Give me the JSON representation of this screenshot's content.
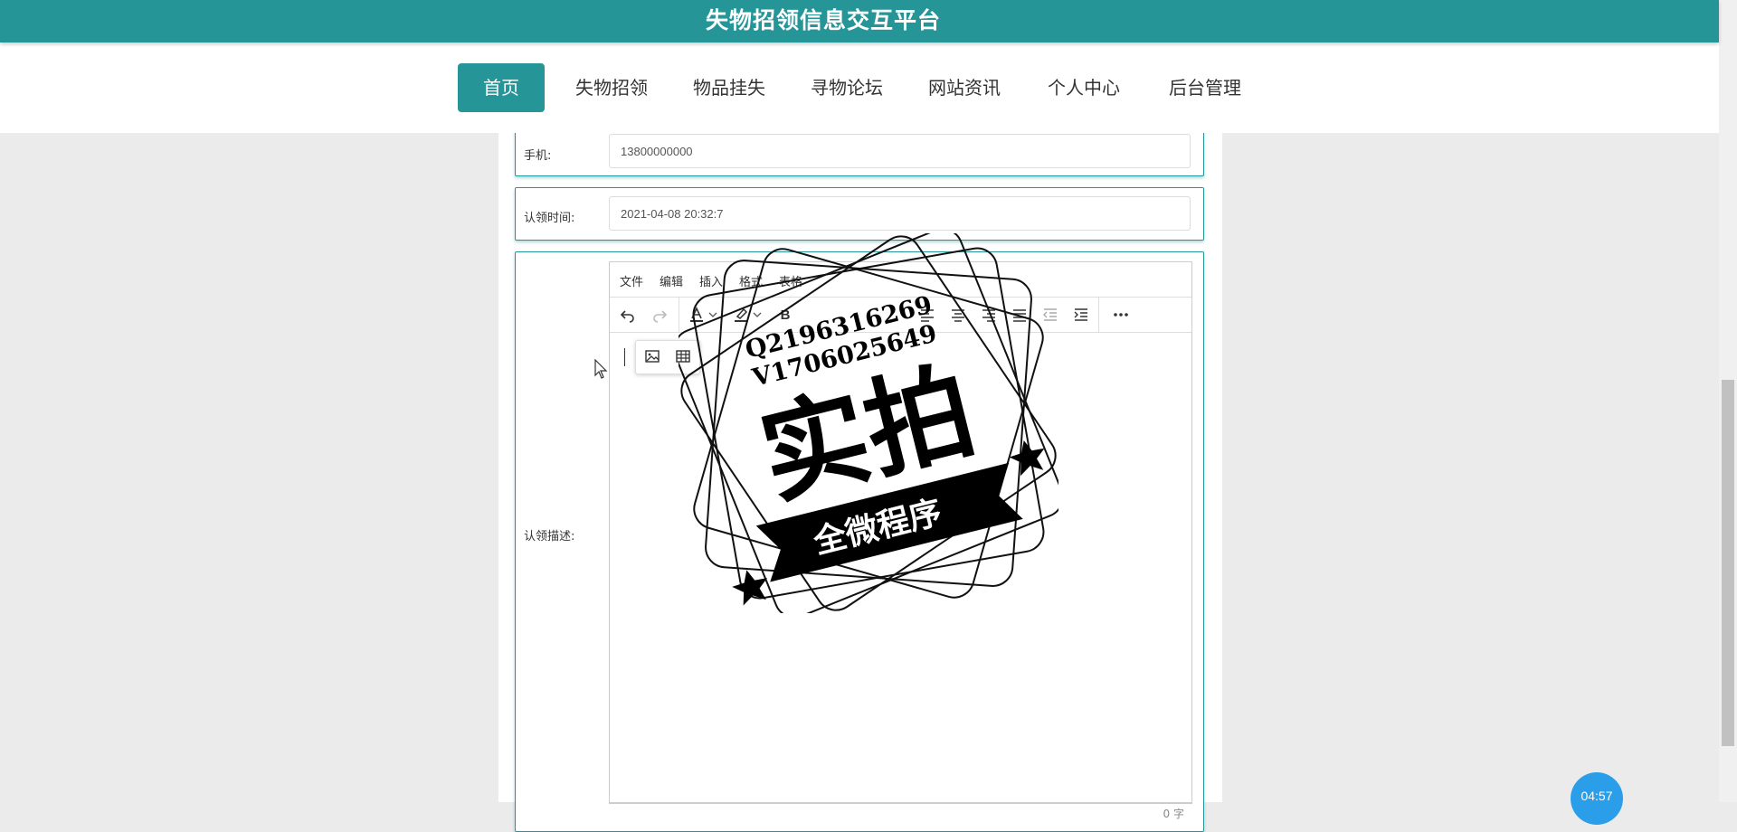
{
  "header": {
    "title": "失物招领信息交互平台"
  },
  "nav": {
    "items": [
      {
        "label": "首页"
      },
      {
        "label": "失物招领"
      },
      {
        "label": "物品挂失"
      },
      {
        "label": "寻物论坛"
      },
      {
        "label": "网站资讯"
      },
      {
        "label": "个人中心"
      },
      {
        "label": "后台管理"
      }
    ]
  },
  "form": {
    "phone": {
      "label": "手机:",
      "value": "13800000000"
    },
    "claim_time": {
      "label": "认领时间:",
      "value": "2021-04-08 20:32:7"
    },
    "description": {
      "label": "认领描述:"
    }
  },
  "editor": {
    "menus": [
      "文件",
      "编辑",
      "插入",
      "格式",
      "表格"
    ],
    "word_count": "0 字"
  },
  "watermark": {
    "contact_q": "Q2196316269",
    "contact_v": "V1706025649",
    "main_text": "实拍",
    "banner_text": "全微程序"
  },
  "timer": {
    "value": "04:57"
  },
  "colors": {
    "brand": "#269598",
    "timer": "#2a9ee8"
  }
}
